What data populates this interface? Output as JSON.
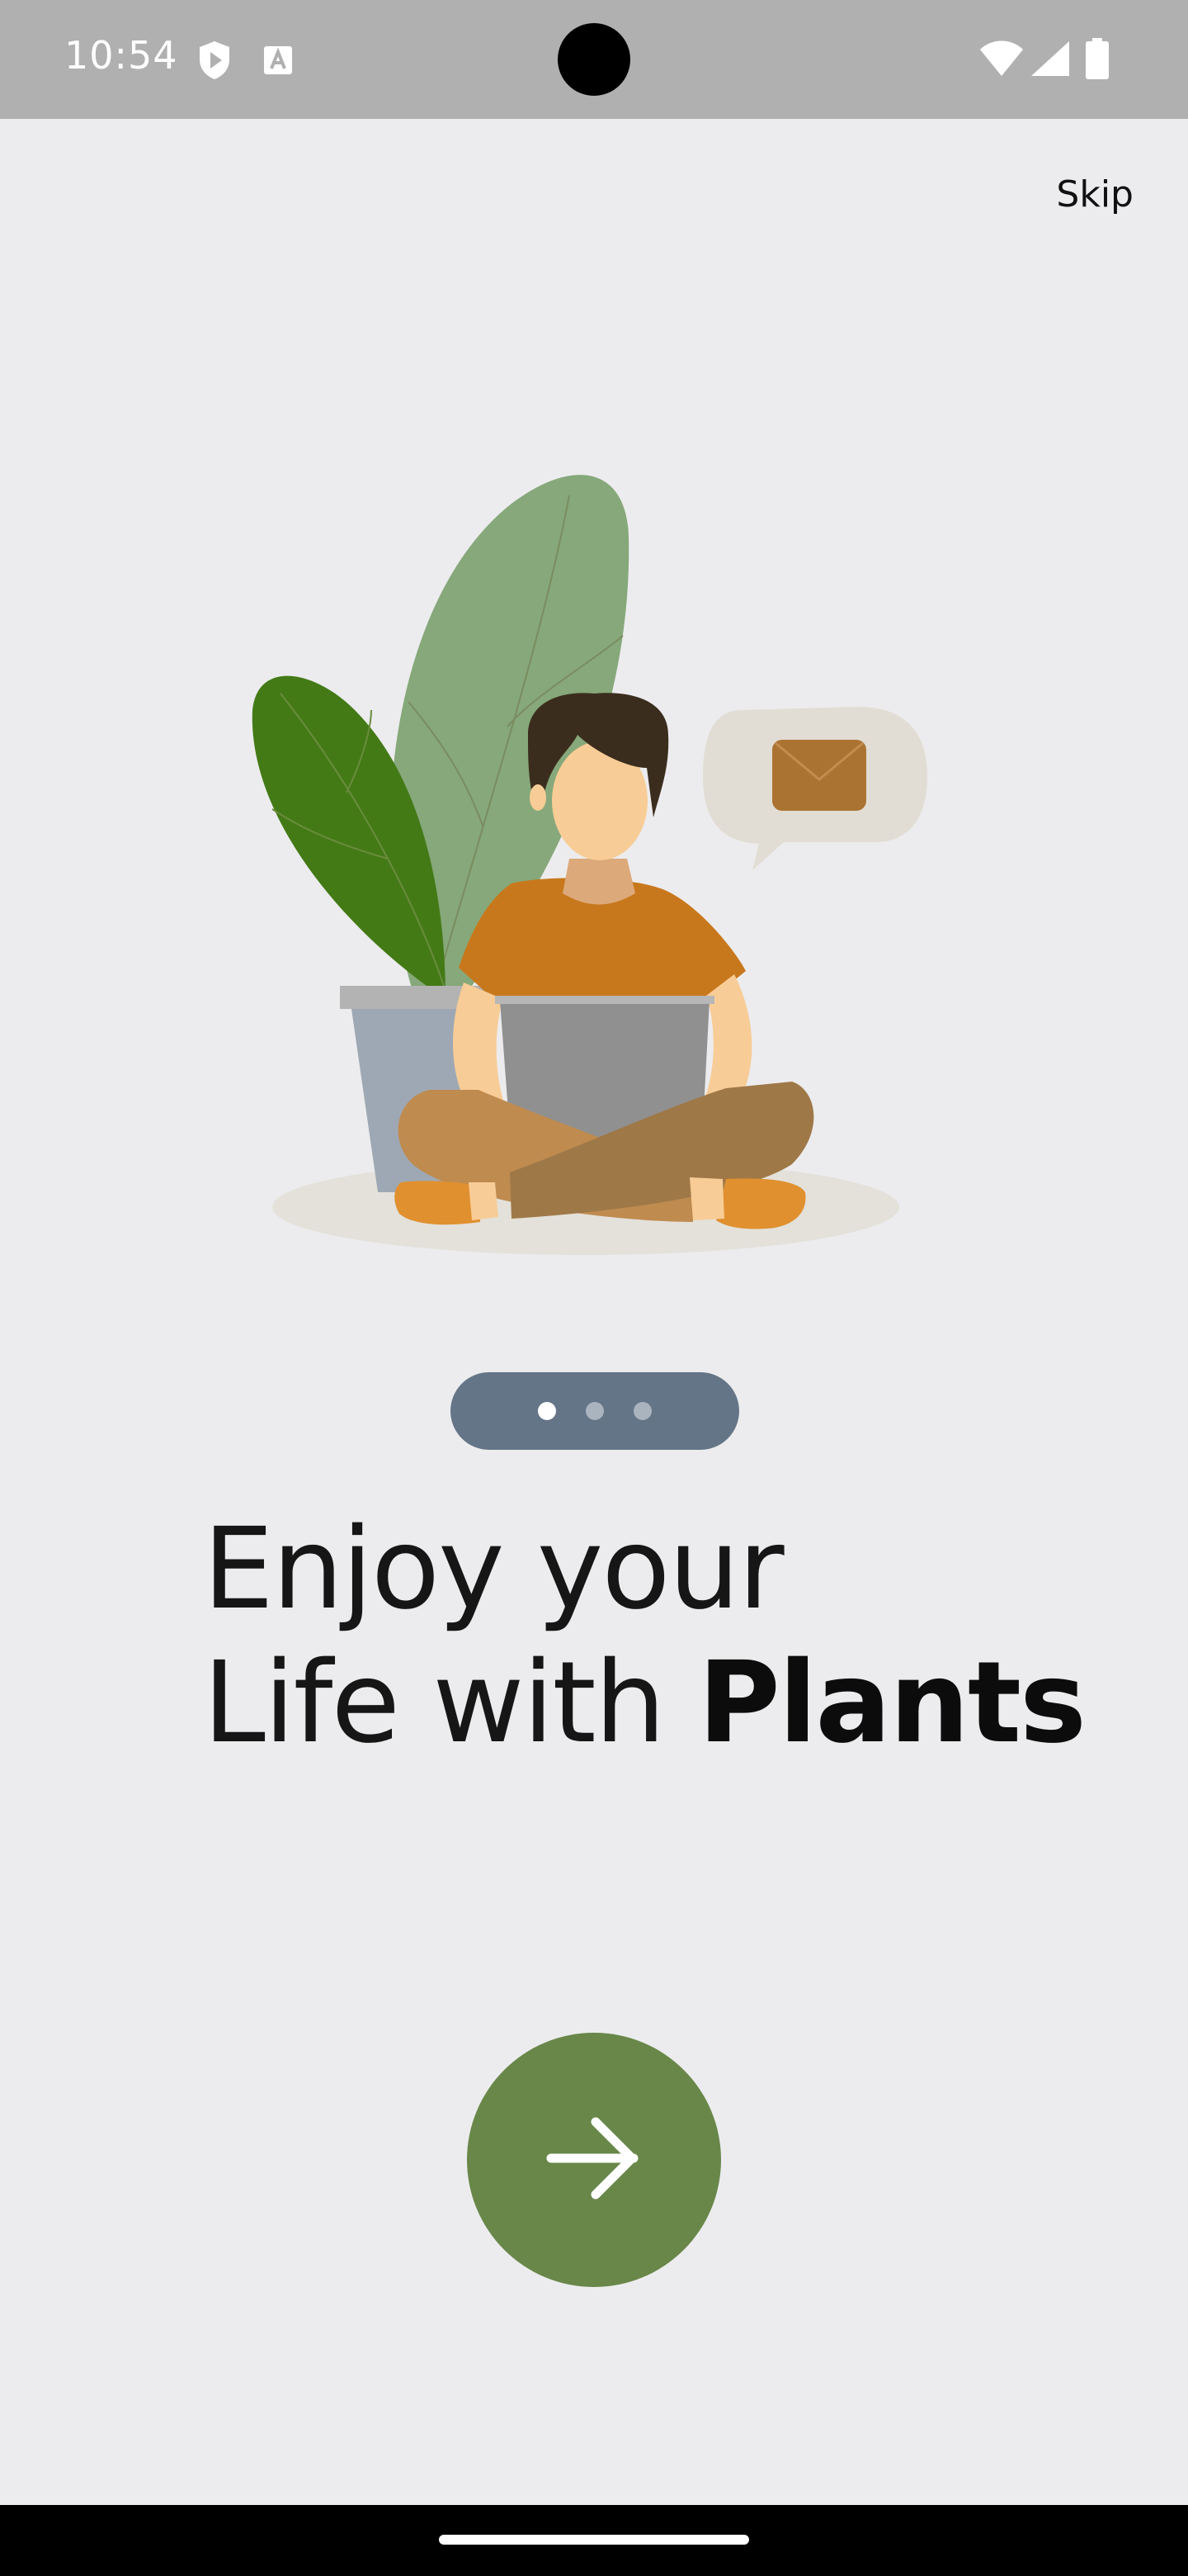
{
  "status_bar": {
    "time": "10:54",
    "icons": [
      "shield-play-icon",
      "font-a-icon",
      "wifi-icon",
      "signal-icon",
      "battery-icon"
    ],
    "background": "#b0b0b0"
  },
  "header": {
    "skip_label": "Skip"
  },
  "illustration": {
    "description_icon": "person-with-laptop-and-plant-illustration"
  },
  "pager": {
    "count": 3,
    "active_index": 0
  },
  "headline": {
    "line1": "Enjoy your",
    "line2_regular": "Life with ",
    "line2_bold": "Plants"
  },
  "next_button": {
    "icon": "arrow-right-icon",
    "color": "#688749"
  },
  "colors": {
    "background": "#ececee",
    "indicator": "#647587",
    "accent": "#688749"
  }
}
